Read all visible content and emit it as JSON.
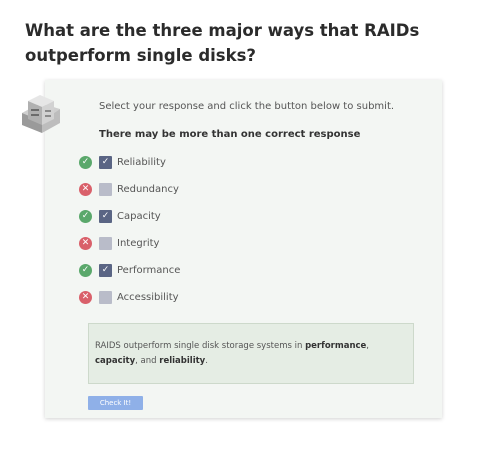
{
  "question": {
    "title": "What are the three major ways that RAIDs outperform single disks?"
  },
  "card": {
    "instructions": "Select your response and click the button below to submit.",
    "hint": "There may be more than one correct response",
    "icon": "server-disk-icon"
  },
  "options": [
    {
      "label": "Reliability",
      "checked": true,
      "correct": true
    },
    {
      "label": "Redundancy",
      "checked": false,
      "correct": false
    },
    {
      "label": "Capacity",
      "checked": true,
      "correct": true
    },
    {
      "label": "Integrity",
      "checked": false,
      "correct": false
    },
    {
      "label": "Performance",
      "checked": true,
      "correct": true
    },
    {
      "label": "Accessibility",
      "checked": false,
      "correct": false
    }
  ],
  "feedback": {
    "prefix": "RAIDS outperform single disk storage systems in ",
    "term1": "performance",
    "sep1": ", ",
    "term2": "capacity",
    "sep2": ", and ",
    "term3": "reliability",
    "suffix": "."
  },
  "button": {
    "label": "Check It!"
  },
  "colors": {
    "correct": "#5aa86b",
    "incorrect": "#d9606a",
    "checkbox_checked": "#5a6584",
    "checkbox_unchecked": "#b9bcc9",
    "button": "#8fb0e8",
    "card_bg": "#f3f6f3",
    "feedback_bg": "#e5ede4"
  }
}
